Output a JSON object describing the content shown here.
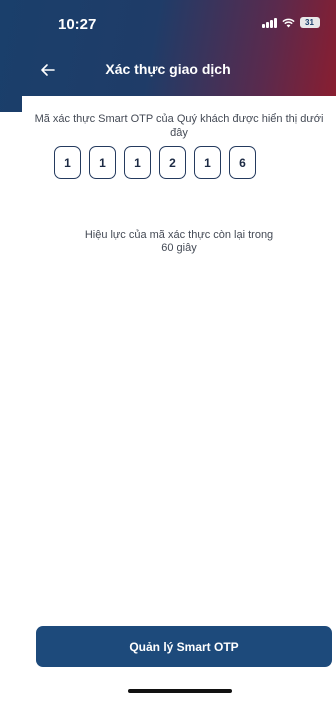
{
  "status_bar": {
    "time": "10:27",
    "battery": "31"
  },
  "nav": {
    "title": "Xác thực giao dịch",
    "back_icon": "arrow-left-icon"
  },
  "otp": {
    "description": "Mã xác thực Smart OTP của Quý khách được hiển thị dưới đây",
    "digits": [
      "1",
      "1",
      "1",
      "2",
      "1",
      "6"
    ],
    "validity_text": "Hiệu lực của mã xác thực còn lại trong",
    "validity_seconds": "60 giây"
  },
  "actions": {
    "manage_label": "Quản lý Smart OTP"
  },
  "colors": {
    "header_start": "#1a3f6b",
    "header_end": "#8b1d2f",
    "primary_button": "#1d4a7b",
    "otp_border": "#243a5e"
  }
}
